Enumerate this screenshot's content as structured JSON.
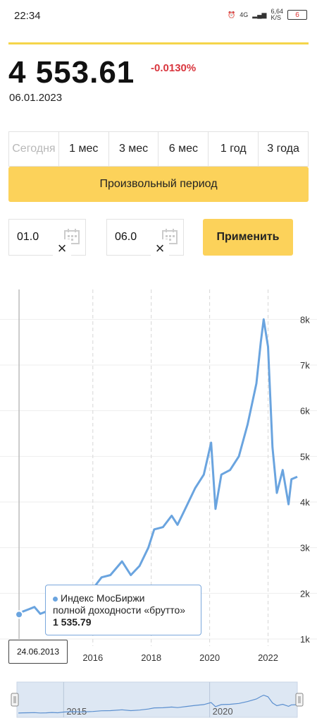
{
  "status": {
    "time": "22:34",
    "network": "4G",
    "speed": "6,64",
    "speed_unit": "K/S",
    "battery": "6"
  },
  "quote": {
    "value": "4 553.61",
    "change": "-0.0130%",
    "date": "06.01.2023"
  },
  "periods": [
    {
      "label": "Сегодня",
      "enabled": false
    },
    {
      "label": "1 мес",
      "enabled": true
    },
    {
      "label": "3 мес",
      "enabled": true
    },
    {
      "label": "6 мес",
      "enabled": true
    },
    {
      "label": "1 год",
      "enabled": true
    },
    {
      "label": "3 года",
      "enabled": true
    }
  ],
  "custom_period_label": "Произвольный период",
  "date_from": {
    "value": "01.0"
  },
  "date_to": {
    "value": "06.0"
  },
  "apply_label": "Применить",
  "colors": {
    "accent": "#fcd25a",
    "series": "#6aa4df",
    "negative": "#d9363e"
  },
  "chart_data": {
    "type": "line",
    "series": [
      {
        "name": "Индекс МосБиржи полной доходности «брутто»",
        "x": [
          2013.45,
          2013.6,
          2013.8,
          2014.0,
          2014.2,
          2014.4,
          2014.6,
          2014.8,
          2015.0,
          2015.3,
          2015.6,
          2016.0,
          2016.3,
          2016.6,
          2017.0,
          2017.3,
          2017.6,
          2017.9,
          2018.1,
          2018.4,
          2018.7,
          2018.9,
          2019.2,
          2019.5,
          2019.8,
          2020.05,
          2020.2,
          2020.4,
          2020.7,
          2021.0,
          2021.3,
          2021.6,
          2021.75,
          2021.85,
          2022.0,
          2022.15,
          2022.3,
          2022.5,
          2022.7,
          2022.8,
          2023.0
        ],
        "y": [
          1535.79,
          1600,
          1650,
          1700,
          1550,
          1600,
          1750,
          1650,
          1900,
          2050,
          1950,
          2100,
          2350,
          2400,
          2700,
          2400,
          2600,
          3000,
          3400,
          3450,
          3700,
          3500,
          3900,
          4300,
          4600,
          5300,
          3850,
          4600,
          4700,
          5000,
          5700,
          6600,
          7500,
          8000,
          7400,
          5200,
          4200,
          4700,
          3950,
          4500,
          4553.61
        ],
        "values_are_estimates": true
      }
    ],
    "x_ticks": [
      "2016",
      "2018",
      "2020",
      "2022"
    ],
    "y_ticks": [
      "1k",
      "2k",
      "3k",
      "4k",
      "5k",
      "6k",
      "7k",
      "8k"
    ],
    "xlim": [
      2013.4,
      2023.0
    ],
    "ylim": [
      1000,
      8500
    ],
    "grid": true,
    "y_axis_side": "right",
    "tooltip": {
      "dot_color": "#6aa4df",
      "line1": "Индекс МосБиржи",
      "line2": "полной доходности «брутто»",
      "value": "1 535.79",
      "x_label": "24.06.2013"
    },
    "navigator_ticks": [
      "2015",
      "2020"
    ]
  }
}
